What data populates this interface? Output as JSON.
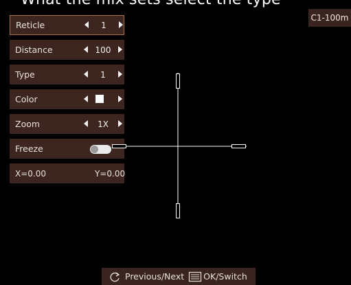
{
  "top_caption": "What the mix sets select the type",
  "badge": "C1-100m",
  "menu": {
    "reticle": {
      "label": "Reticle",
      "value": "1"
    },
    "distance": {
      "label": "Distance",
      "value": "100"
    },
    "type": {
      "label": "Type",
      "value": "1"
    },
    "color": {
      "label": "Color",
      "value_color": "#ffffff"
    },
    "zoom": {
      "label": "Zoom",
      "value": "1X"
    },
    "freeze": {
      "label": "Freeze",
      "state": "off"
    },
    "coords": {
      "x": "X=0.00",
      "y": "Y=0.00"
    }
  },
  "footer": {
    "prev_next": "Previous/Next",
    "ok_switch": "OK/Switch"
  },
  "colors": {
    "panel": "#3d2520",
    "highlight_border": "#b07045",
    "reticle": "#ffffff"
  }
}
